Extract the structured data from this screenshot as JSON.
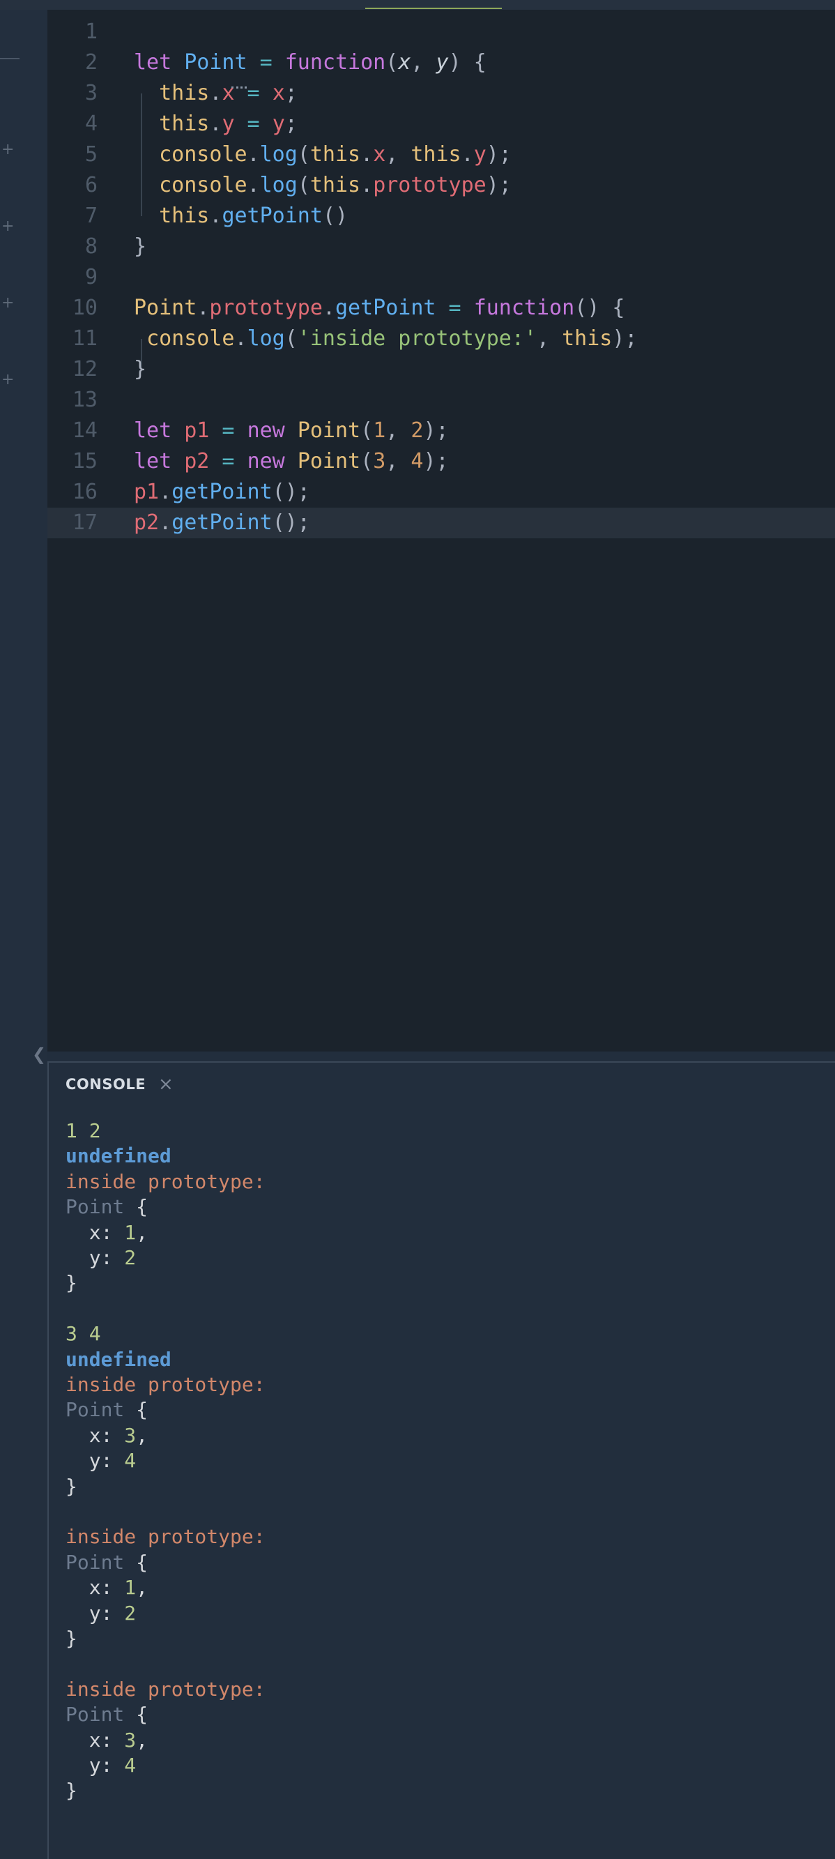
{
  "editor": {
    "lines": [
      {
        "n": "1",
        "tokens": []
      },
      {
        "n": "2",
        "tokens": [
          [
            "kw",
            "let "
          ],
          [
            "fn",
            "Point"
          ],
          [
            "op",
            " = "
          ],
          [
            "kw",
            "function"
          ],
          [
            "pu",
            "("
          ],
          [
            "pm",
            "x"
          ],
          [
            "pu",
            ", "
          ],
          [
            "pm",
            "y"
          ],
          [
            "pu",
            ") {"
          ]
        ]
      },
      {
        "n": "3",
        "tokens": [
          [
            "pu",
            "  "
          ],
          [
            "id",
            "this"
          ],
          [
            "pu",
            "."
          ],
          [
            "pr",
            "x"
          ],
          [
            "op",
            " = "
          ],
          [
            "pr",
            "x"
          ],
          [
            "pu",
            ";"
          ]
        ]
      },
      {
        "n": "4",
        "tokens": [
          [
            "pu",
            "  "
          ],
          [
            "id",
            "this"
          ],
          [
            "pu",
            "."
          ],
          [
            "pr",
            "y"
          ],
          [
            "op",
            " = "
          ],
          [
            "pr",
            "y"
          ],
          [
            "pu",
            ";"
          ]
        ]
      },
      {
        "n": "5",
        "tokens": [
          [
            "pu",
            "  "
          ],
          [
            "id",
            "console"
          ],
          [
            "pu",
            "."
          ],
          [
            "fn",
            "log"
          ],
          [
            "pu",
            "("
          ],
          [
            "id",
            "this"
          ],
          [
            "pu",
            "."
          ],
          [
            "pr",
            "x"
          ],
          [
            "pu",
            ", "
          ],
          [
            "id",
            "this"
          ],
          [
            "pu",
            "."
          ],
          [
            "pr",
            "y"
          ],
          [
            "pu",
            ");"
          ]
        ]
      },
      {
        "n": "6",
        "tokens": [
          [
            "pu",
            "  "
          ],
          [
            "id",
            "console"
          ],
          [
            "pu",
            "."
          ],
          [
            "fn",
            "log"
          ],
          [
            "pu",
            "("
          ],
          [
            "id",
            "this"
          ],
          [
            "pu",
            "."
          ],
          [
            "pr",
            "prototype"
          ],
          [
            "pu",
            ");"
          ]
        ]
      },
      {
        "n": "7",
        "tokens": [
          [
            "pu",
            "  "
          ],
          [
            "id",
            "this"
          ],
          [
            "pu",
            "."
          ],
          [
            "fn",
            "getPoint"
          ],
          [
            "pu",
            "()"
          ]
        ]
      },
      {
        "n": "8",
        "tokens": [
          [
            "pu",
            "}"
          ]
        ]
      },
      {
        "n": "9",
        "tokens": []
      },
      {
        "n": "10",
        "tokens": [
          [
            "id",
            "Point"
          ],
          [
            "pu",
            "."
          ],
          [
            "pr",
            "prototype"
          ],
          [
            "pu",
            "."
          ],
          [
            "fn",
            "getPoint"
          ],
          [
            "op",
            " = "
          ],
          [
            "kw",
            "function"
          ],
          [
            "pu",
            "() {"
          ]
        ]
      },
      {
        "n": "11",
        "tokens": [
          [
            "pu",
            " "
          ],
          [
            "id",
            "console"
          ],
          [
            "pu",
            "."
          ],
          [
            "fn",
            "log"
          ],
          [
            "pu",
            "("
          ],
          [
            "str",
            "'inside prototype:'"
          ],
          [
            "pu",
            ", "
          ],
          [
            "id",
            "this"
          ],
          [
            "pu",
            ");"
          ]
        ]
      },
      {
        "n": "12",
        "tokens": [
          [
            "pu",
            "}"
          ]
        ]
      },
      {
        "n": "13",
        "tokens": []
      },
      {
        "n": "14",
        "tokens": [
          [
            "kw",
            "let "
          ],
          [
            "pr",
            "p1"
          ],
          [
            "op",
            " = "
          ],
          [
            "kw",
            "new "
          ],
          [
            "id",
            "Point"
          ],
          [
            "pu",
            "("
          ],
          [
            "num",
            "1"
          ],
          [
            "pu",
            ", "
          ],
          [
            "num",
            "2"
          ],
          [
            "pu",
            ");"
          ]
        ]
      },
      {
        "n": "15",
        "tokens": [
          [
            "kw",
            "let "
          ],
          [
            "pr",
            "p2"
          ],
          [
            "op",
            " = "
          ],
          [
            "kw",
            "new "
          ],
          [
            "id",
            "Point"
          ],
          [
            "pu",
            "("
          ],
          [
            "num",
            "3"
          ],
          [
            "pu",
            ", "
          ],
          [
            "num",
            "4"
          ],
          [
            "pu",
            ");"
          ]
        ]
      },
      {
        "n": "16",
        "tokens": [
          [
            "pr",
            "p1"
          ],
          [
            "pu",
            "."
          ],
          [
            "fn",
            "getPoint"
          ],
          [
            "pu",
            "();"
          ]
        ]
      },
      {
        "n": "17",
        "tokens": [
          [
            "pr",
            "p2"
          ],
          [
            "pu",
            "."
          ],
          [
            "fn",
            "getPoint"
          ],
          [
            "pu",
            "();"
          ]
        ]
      }
    ]
  },
  "console": {
    "title": "CONSOLE",
    "close_icon": "×",
    "chevron_icon": "❮",
    "lines": [
      {
        "kind": "num2",
        "text": "1 2",
        "top": 0
      },
      {
        "kind": "undef",
        "text": "undefined"
      },
      {
        "kind": "msg",
        "text": "inside prototype:"
      },
      {
        "kind": "obj-open",
        "cls": "Point",
        "text": " {"
      },
      {
        "kind": "prop",
        "key": "  x: ",
        "val": "1",
        "tail": ","
      },
      {
        "kind": "prop",
        "key": "  y: ",
        "val": "2",
        "tail": ""
      },
      {
        "kind": "plain",
        "text": "}"
      },
      {
        "kind": "blank",
        "text": ""
      },
      {
        "kind": "num2",
        "text": "3 4"
      },
      {
        "kind": "undef",
        "text": "undefined"
      },
      {
        "kind": "msg",
        "text": "inside prototype:"
      },
      {
        "kind": "obj-open",
        "cls": "Point",
        "text": " {"
      },
      {
        "kind": "prop",
        "key": "  x: ",
        "val": "3",
        "tail": ","
      },
      {
        "kind": "prop",
        "key": "  y: ",
        "val": "4",
        "tail": ""
      },
      {
        "kind": "plain",
        "text": "}"
      },
      {
        "kind": "blank",
        "text": ""
      },
      {
        "kind": "msg",
        "text": "inside prototype:"
      },
      {
        "kind": "obj-open",
        "cls": "Point",
        "text": " {"
      },
      {
        "kind": "prop",
        "key": "  x: ",
        "val": "1",
        "tail": ","
      },
      {
        "kind": "prop",
        "key": "  y: ",
        "val": "2",
        "tail": ""
      },
      {
        "kind": "plain",
        "text": "}"
      },
      {
        "kind": "blank",
        "text": ""
      },
      {
        "kind": "msg",
        "text": "inside prototype:"
      },
      {
        "kind": "obj-open",
        "cls": "Point",
        "text": " {"
      },
      {
        "kind": "prop",
        "key": "  x: ",
        "val": "3",
        "tail": ","
      },
      {
        "kind": "prop",
        "key": "  y: ",
        "val": "4",
        "tail": ""
      },
      {
        "kind": "plain",
        "text": "}"
      }
    ]
  },
  "gutter": {
    "plus_icon": "+"
  },
  "colors": {
    "editor_bg": "#1b232c",
    "console_bg": "#222e3d",
    "active_line": "#28313c",
    "tab_indicator": "#8fa85a"
  }
}
